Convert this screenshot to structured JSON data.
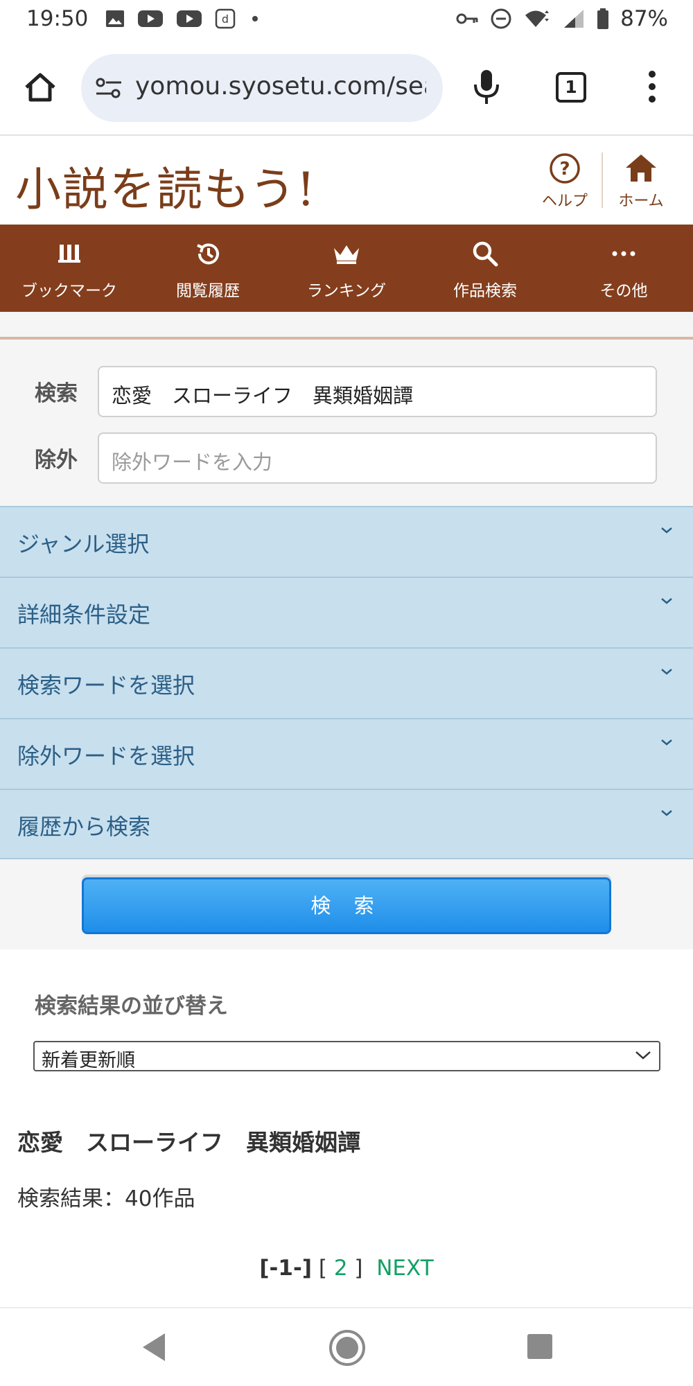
{
  "status": {
    "time": "19:50",
    "battery": "87%",
    "left_icons": [
      "image-icon",
      "youtube-icon",
      "youtube-icon",
      "d-app-icon",
      "dot-icon"
    ],
    "right_icons": [
      "vpn-key-icon",
      "do-not-disturb-icon",
      "wifi-icon",
      "signal-icon",
      "battery-icon"
    ]
  },
  "browser": {
    "url": "yomou.syosetu.com/sea",
    "tab_count": "1"
  },
  "site": {
    "logo": "小説を読もう!",
    "help_label": "ヘルプ",
    "home_label": "ホーム"
  },
  "nav": [
    {
      "label": "ブックマーク",
      "icon": "bookmark-icon"
    },
    {
      "label": "閲覧履歴",
      "icon": "history-icon"
    },
    {
      "label": "ランキング",
      "icon": "crown-icon"
    },
    {
      "label": "作品検索",
      "icon": "search-icon"
    },
    {
      "label": "その他",
      "icon": "more-icon"
    }
  ],
  "search": {
    "keyword_label": "検索",
    "keyword_value": "恋愛　スローライフ　異類婚姻譚",
    "exclude_label": "除外",
    "exclude_placeholder": "除外ワードを入力",
    "accordions": [
      "ジャンル選択",
      "詳細条件設定",
      "検索ワードを選択",
      "除外ワードを選択",
      "履歴から検索"
    ],
    "button_label": "検 索"
  },
  "results": {
    "sort_label": "検索結果の並び替え",
    "sort_value": "新着更新順",
    "query_title": "恋愛　スローライフ　異類婚姻譚",
    "count_text": "検索結果：40作品",
    "pager_current": "[-1-]",
    "pager_open": "[",
    "pager_page2": "2",
    "pager_close": "]",
    "pager_next": "NEXT"
  },
  "colors": {
    "brand_brown": "#843e1d",
    "accordion_bg": "#c8dfee",
    "search_button": "#2196f3",
    "link_green": "#12a066"
  }
}
